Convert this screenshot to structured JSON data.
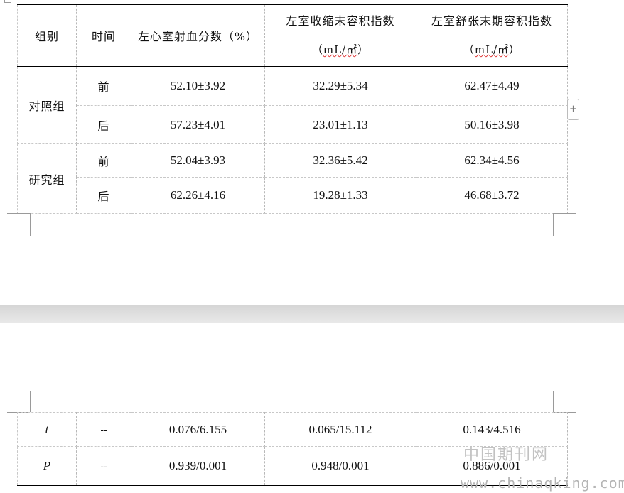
{
  "table_top": {
    "headers": {
      "group": "组别",
      "time": "时间",
      "lvef": "左心室射血分数（%）",
      "lvesvi": "左室收缩末容积指数",
      "lvesvi_unit_pre": "（",
      "lvesvi_unit": "mL/㎡",
      "lvesvi_unit_post": "）",
      "lvedvi": "左室舒张末期容积指数",
      "lvedvi_unit_pre": "（",
      "lvedvi_unit": "mL/㎡",
      "lvedvi_unit_post": "）"
    },
    "groups": [
      {
        "name": "对照组",
        "rows": [
          {
            "time": "前",
            "lvef": "52.10±3.92",
            "lvesvi": "32.29±5.34",
            "lvedvi": "62.47±4.49"
          },
          {
            "time": "后",
            "lvef": "57.23±4.01",
            "lvesvi": "23.01±1.13",
            "lvedvi": "50.16±3.98"
          }
        ]
      },
      {
        "name": "研究组",
        "rows": [
          {
            "time": "前",
            "lvef": "52.04±3.93",
            "lvesvi": "32.36±5.42",
            "lvedvi": "62.34±4.56"
          },
          {
            "time": "后",
            "lvef": "62.26±4.16",
            "lvesvi": "19.28±1.33",
            "lvedvi": "46.68±3.72"
          }
        ]
      }
    ]
  },
  "table_bottom": {
    "rows": [
      {
        "label": "t",
        "time": "--",
        "lvef": "0.076/6.155",
        "lvesvi": "0.065/15.112",
        "lvedvi": "0.143/4.516"
      },
      {
        "label": "P",
        "time": "--",
        "lvef": "0.939/0.001",
        "lvesvi": "0.948/0.001",
        "lvedvi": "0.886/0.001"
      }
    ]
  },
  "ui": {
    "add_row_button": "+",
    "add_row_icon": "plus-icon"
  },
  "watermark": {
    "cn": "中国期刊网",
    "en": "www.chinaqking.com"
  }
}
